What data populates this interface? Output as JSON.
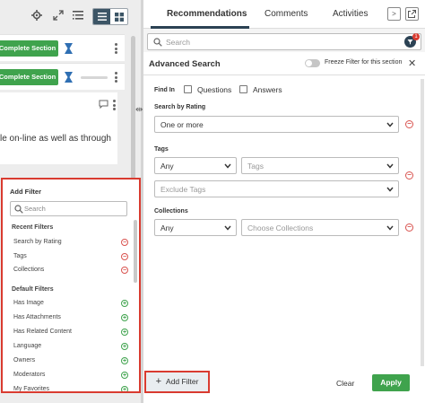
{
  "left": {
    "tasks": [
      {
        "button_label": "Complete Section"
      },
      {
        "button_label": "Complete Section"
      }
    ],
    "doc_text": "le on-line as well as through"
  },
  "add_filter": {
    "title": "Add Filter",
    "search_placeholder": "Search",
    "recent_title": "Recent Filters",
    "recent": [
      "Search by Rating",
      "Tags",
      "Collections"
    ],
    "default_title": "Default Filters",
    "defaults": [
      "Has Image",
      "Has Attachments",
      "Has Related Content",
      "Language",
      "Owners",
      "Moderators",
      "My Favorites"
    ]
  },
  "tabs": {
    "recommendations": "Recommendations",
    "comments": "Comments",
    "activities": "Activities",
    "next": ">"
  },
  "search": {
    "placeholder": "Search",
    "filter_badge": "1"
  },
  "advanced": {
    "title": "Advanced Search",
    "freeze_label": "Freeze Filter for this section",
    "find_in_label": "Find In",
    "questions_label": "Questions",
    "answers_label": "Answers",
    "rating_label": "Search by Rating",
    "rating_value": "One or more",
    "tags_label": "Tags",
    "tags_mode": "Any",
    "tags_placeholder": "Tags",
    "exclude_placeholder": "Exclude Tags",
    "collections_label": "Collections",
    "collections_mode": "Any",
    "collections_placeholder": "Choose Collections"
  },
  "footer": {
    "add_filter": "Add Filter",
    "add_icon": "+",
    "clear": "Clear",
    "apply": "Apply"
  },
  "colors": {
    "accent": "#3fa34d",
    "dark": "#2c4254",
    "highlight": "#d93b30"
  }
}
